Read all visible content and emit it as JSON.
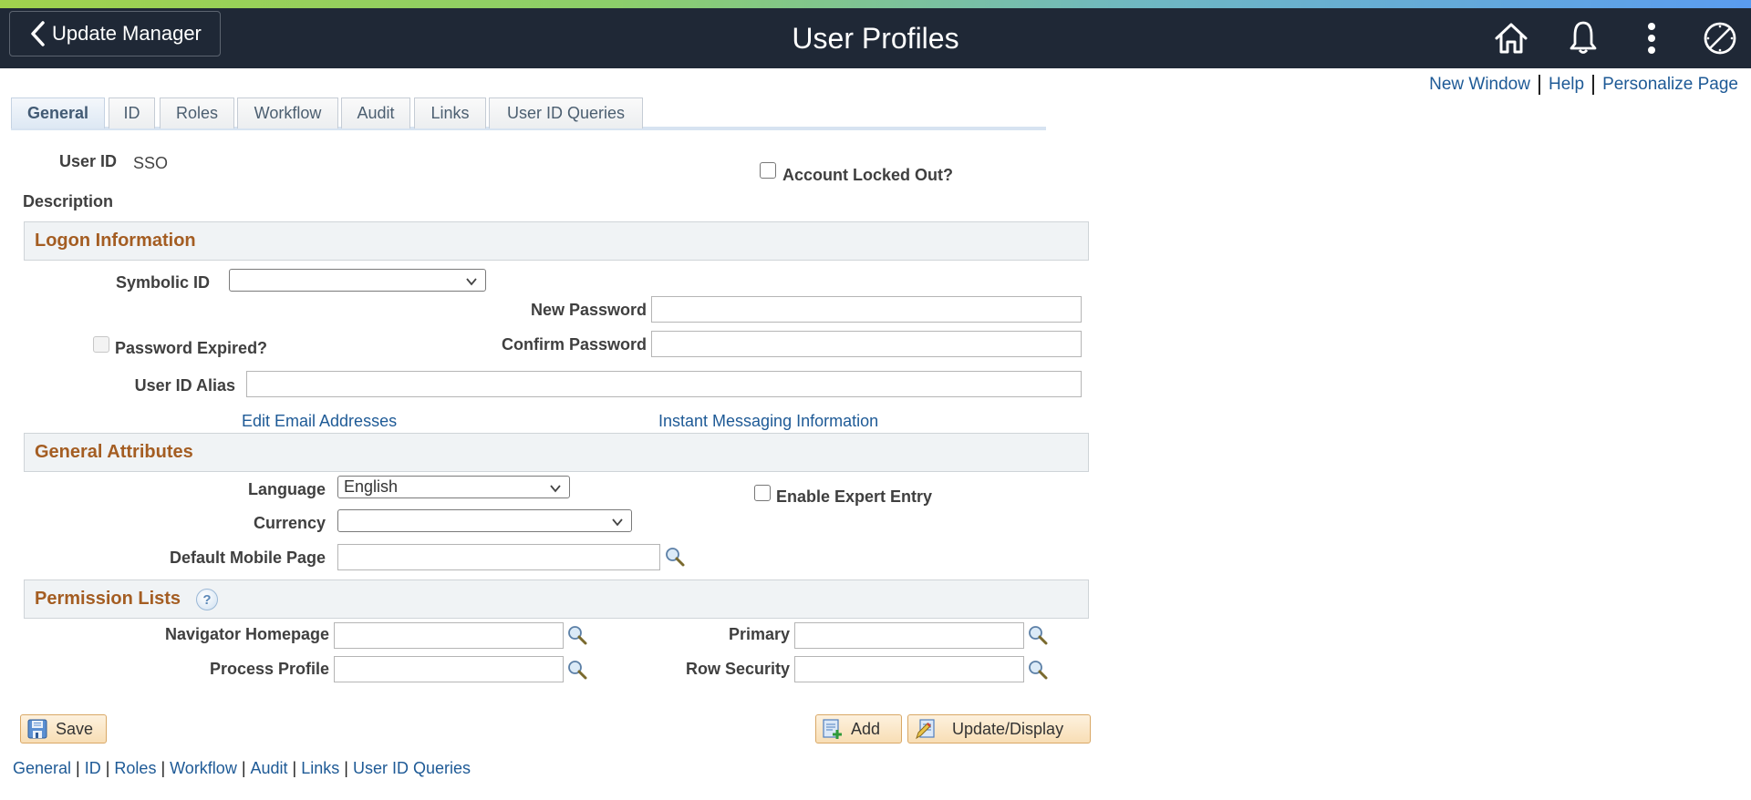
{
  "header": {
    "back_button_label": "Update Manager",
    "title": "User Profiles",
    "icons": [
      "home-icon",
      "bell-icon",
      "more-options-icon",
      "compass-navbar-icon"
    ]
  },
  "top_links": [
    "New Window",
    "Help",
    "Personalize Page"
  ],
  "tabs": [
    {
      "label": "General",
      "active": true
    },
    {
      "label": "ID",
      "active": false
    },
    {
      "label": "Roles",
      "active": false
    },
    {
      "label": "Workflow",
      "active": false
    },
    {
      "label": "Audit",
      "active": false
    },
    {
      "label": "Links",
      "active": false
    },
    {
      "label": "User ID Queries",
      "active": false
    }
  ],
  "user": {
    "user_id_label": "User ID",
    "user_id_value": "SSO",
    "account_locked_label": "Account Locked Out?",
    "account_locked_checked": false,
    "description_label": "Description"
  },
  "logon": {
    "section_title": "Logon Information",
    "symbolic_id_label": "Symbolic ID",
    "symbolic_id_value": "",
    "new_password_label": "New Password",
    "new_password_value": "",
    "confirm_password_label": "Confirm Password",
    "confirm_password_value": "",
    "password_expired_label": "Password Expired?",
    "password_expired_checked": false,
    "user_id_alias_label": "User ID Alias",
    "user_id_alias_value": "",
    "edit_email_link": "Edit Email Addresses",
    "instant_messaging_link": "Instant Messaging Information"
  },
  "general_attributes": {
    "section_title": "General Attributes",
    "language_label": "Language",
    "language_value": "English",
    "enable_expert_entry_label": "Enable Expert Entry",
    "enable_expert_entry_checked": false,
    "currency_label": "Currency",
    "currency_value": "",
    "default_mobile_page_label": "Default Mobile Page",
    "default_mobile_page_value": ""
  },
  "permission_lists": {
    "section_title": "Permission Lists",
    "help_icon": "?",
    "navigator_homepage_label": "Navigator Homepage",
    "navigator_homepage_value": "",
    "process_profile_label": "Process Profile",
    "process_profile_value": "",
    "primary_label": "Primary",
    "primary_value": "",
    "row_security_label": "Row Security",
    "row_security_value": ""
  },
  "buttons": {
    "save": "Save",
    "add": "Add",
    "update_display": "Update/Display"
  },
  "bottom_links": [
    "General",
    "ID",
    "Roles",
    "Workflow",
    "Audit",
    "Links",
    "User ID Queries"
  ],
  "colors": {
    "header_bg": "#1f2836",
    "section_title": "#a45d22",
    "link": "#1e5a96",
    "button_bg": "#f8deb5"
  }
}
